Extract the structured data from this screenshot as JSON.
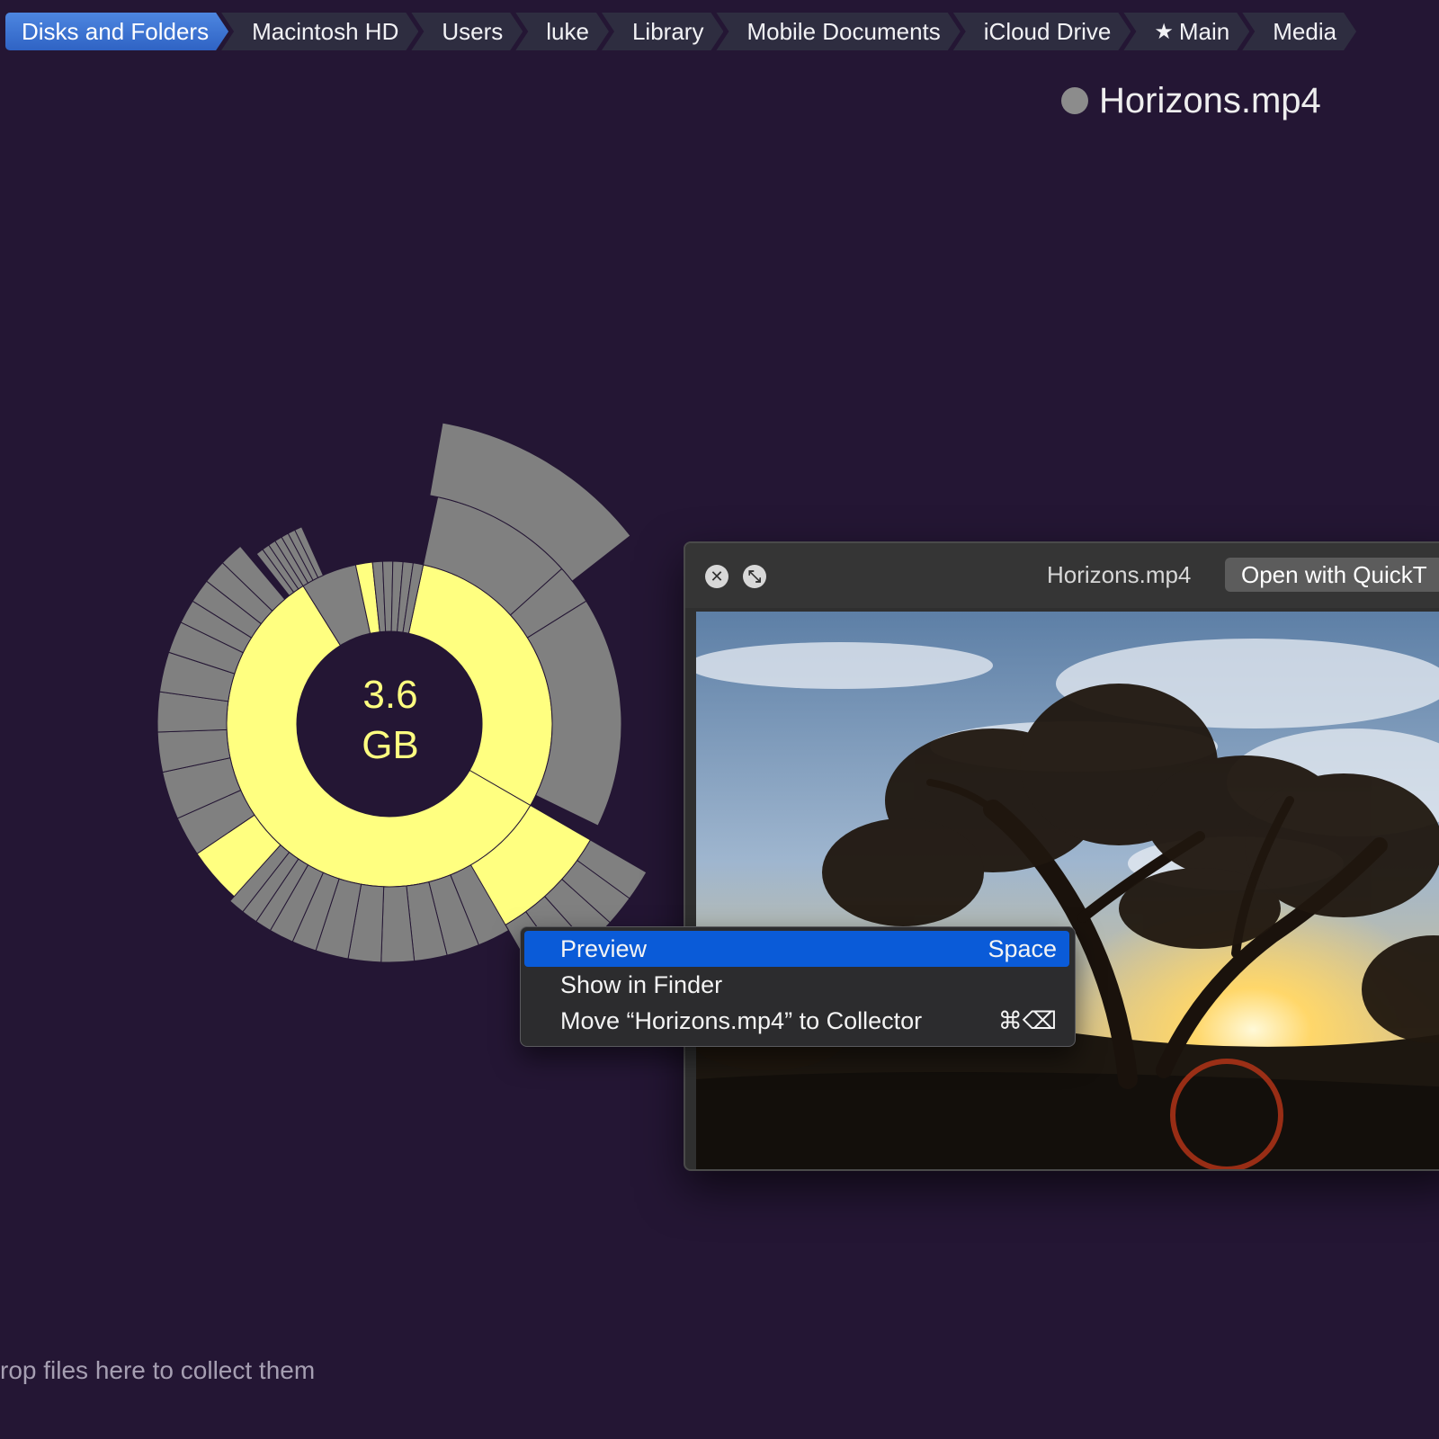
{
  "breadcrumb": {
    "items": [
      {
        "label": "Disks and Folders",
        "active": true
      },
      {
        "label": "Macintosh HD"
      },
      {
        "label": "Users"
      },
      {
        "label": "luke"
      },
      {
        "label": "Library"
      },
      {
        "label": "Mobile Documents"
      },
      {
        "label": "iCloud Drive"
      },
      {
        "label": "Main",
        "icon": "star-icon"
      },
      {
        "label": "Media"
      }
    ]
  },
  "selected_file": {
    "name": "Horizons.mp4",
    "dot_color": "#8c8c8c"
  },
  "sunburst": {
    "center_value": "3.6",
    "center_unit": "GB",
    "highlight_color": "#ffff80",
    "neutral_color": "#808080"
  },
  "quicklook": {
    "title": "Horizons.mp4",
    "open_button": "Open with QuickT",
    "close_icon": "close-icon",
    "fullscreen_icon": "fullscreen-icon"
  },
  "context_menu": {
    "items": [
      {
        "label": "Preview",
        "shortcut": "Space",
        "highlighted": true
      },
      {
        "label": "Show in Finder",
        "shortcut": ""
      },
      {
        "label": "Move “Horizons.mp4” to Collector",
        "shortcut": "⌘⌫"
      }
    ]
  },
  "collector": {
    "hint": "rop files here to collect them"
  }
}
